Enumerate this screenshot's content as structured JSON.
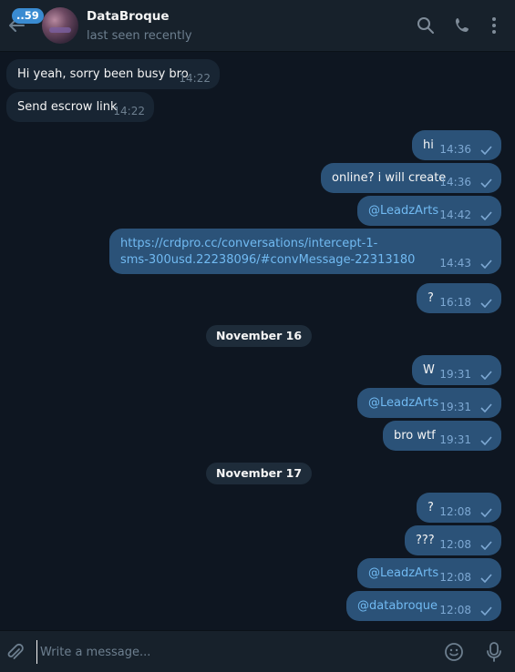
{
  "header": {
    "unread_count": "..59",
    "chat_name": "DataBroque",
    "status": "last seen recently",
    "icons": [
      "back-arrow-icon",
      "search-icon",
      "phone-icon",
      "more-vert-icon",
      "avatar"
    ]
  },
  "messages": [
    {
      "dir": "in",
      "text": "Hi yeah, sorry been busy bro",
      "time": "14:22"
    },
    {
      "dir": "in",
      "text": "Send escrow link",
      "time": "14:22"
    },
    {
      "dir": "out",
      "text": "hi",
      "time": "14:36"
    },
    {
      "dir": "out",
      "text": "online? i will create",
      "time": "14:36"
    },
    {
      "dir": "out",
      "text": "@LeadzArts",
      "time": "14:42",
      "link": true
    },
    {
      "dir": "out",
      "text_line1": "https://crdpro.cc/conversations/intercept-1-",
      "text_line2": "sms-300usd.22238096/#convMessage-22313180",
      "time": "14:43",
      "link": true
    },
    {
      "dir": "out",
      "text": "?",
      "time": "16:18"
    },
    {
      "date": "November 16"
    },
    {
      "dir": "out",
      "text": "W",
      "time": "19:31"
    },
    {
      "dir": "out",
      "text": "@LeadzArts",
      "time": "19:31",
      "link": true
    },
    {
      "dir": "out",
      "text": "bro wtf",
      "time": "19:31"
    },
    {
      "date": "November 17"
    },
    {
      "dir": "out",
      "text": "?",
      "time": "12:08"
    },
    {
      "dir": "out",
      "text": "???",
      "time": "12:08"
    },
    {
      "dir": "out",
      "text": "@LeadzArts",
      "time": "12:08",
      "link": true
    },
    {
      "dir": "out",
      "text": "@databroque",
      "time": "12:08",
      "link": true
    }
  ],
  "composer": {
    "placeholder": "Write a message...",
    "icons": [
      "attach-icon",
      "emoji-icon",
      "mic-icon"
    ]
  },
  "colors": {
    "background": "#0e1621",
    "header": "#17212b",
    "incoming_bubble": "#182533",
    "outgoing_bubble": "#2b5278",
    "link": "#71baf2",
    "accent": "#3a8bd1"
  }
}
